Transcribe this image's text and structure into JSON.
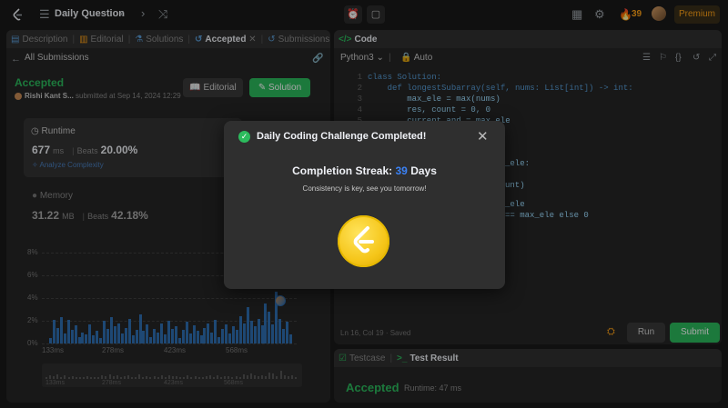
{
  "topbar": {
    "title": "Daily Question",
    "streak_count": "39",
    "premium_label": "Premium"
  },
  "left_tabs": [
    {
      "label": "Description"
    },
    {
      "label": "Editorial"
    },
    {
      "label": "Solutions"
    },
    {
      "label": "Accepted"
    },
    {
      "label": "Submissions"
    }
  ],
  "submission": {
    "back_label": "All Submissions",
    "status": "Accepted",
    "user": "Rishi Kant S...",
    "submitted_text": "submitted at Sep 14, 2024 12:29",
    "editorial_label": "Editorial",
    "solution_label": "Solution"
  },
  "runtime": {
    "label": "Runtime",
    "value": "677",
    "unit": "ms",
    "beats_label": "Beats",
    "beats": "20.00%",
    "analyze": "Analyze Complexity"
  },
  "memory": {
    "label": "Memory",
    "value": "31.22",
    "unit": "MB",
    "beats_label": "Beats",
    "beats": "42.18%"
  },
  "chart_data": {
    "type": "bar",
    "yticks": [
      "8%",
      "6%",
      "4%",
      "2%",
      "0%"
    ],
    "ylim": [
      0,
      8
    ],
    "xticks": [
      "133ms",
      "278ms",
      "423ms",
      "568ms"
    ],
    "values": [
      0.5,
      2.1,
      1.4,
      2.3,
      0.9,
      2.1,
      1.2,
      1.6,
      0.6,
      1.0,
      0.8,
      1.7,
      0.7,
      1.1,
      0.5,
      2.0,
      1.3,
      2.3,
      1.5,
      1.8,
      0.9,
      1.4,
      2.2,
      0.7,
      1.2,
      2.6,
      1.1,
      1.7,
      0.6,
      1.3,
      1.0,
      1.8,
      0.8,
      2.0,
      1.3,
      1.5,
      0.5,
      1.2,
      1.9,
      0.9,
      1.6,
      1.1,
      0.7,
      1.4,
      1.8,
      1.0,
      2.1,
      0.6,
      1.3,
      1.7,
      0.9,
      1.5,
      1.2,
      2.4,
      1.8,
      3.2,
      2.0,
      1.5,
      2.2,
      1.6,
      3.5,
      2.8,
      1.7,
      4.6,
      2.2,
      1.3,
      1.9,
      0.8
    ]
  },
  "overview_ticks": [
    "133ms",
    "278ms",
    "423ms",
    "568ms"
  ],
  "code_panel": {
    "title": "Code",
    "language": "Python3",
    "auto": "Auto",
    "lines": [
      {
        "n": "1",
        "text": "class Solution:"
      },
      {
        "n": "2",
        "text": "    def longestSubarray(self, nums: List[int]) -> int:"
      },
      {
        "n": "3",
        "text": "        max_ele = max(nums)"
      },
      {
        "n": "4",
        "text": "        res, count = 0, 0"
      },
      {
        "n": "5",
        "text": "        current_and = max_ele"
      }
    ],
    "frag_1": "_ele:",
    "frag_2": "unt)",
    "frag_3": "_ele",
    "frag_4": "== max_ele else 0",
    "status": "Ln 16, Col 19  ·  Saved",
    "run_label": "Run",
    "submit_label": "Submit"
  },
  "test": {
    "tab_testcase": "Testcase",
    "tab_result": "Test Result",
    "status": "Accepted",
    "runtime": "Runtime: 47 ms"
  },
  "modal": {
    "title": "Daily Coding Challenge Completed!",
    "streak_prefix": "Completion Streak:",
    "streak_number": "39",
    "streak_suffix": "Days",
    "message": "Consistency is key, see you tomorrow!"
  }
}
